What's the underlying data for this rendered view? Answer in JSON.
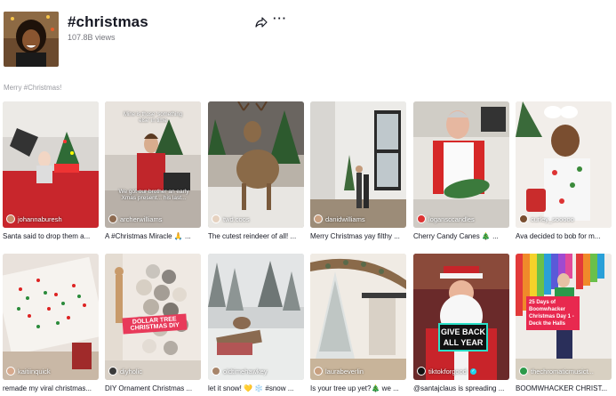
{
  "header": {
    "title": "#christmas",
    "views": "107.8B views",
    "share_icon": "share-arrow-icon",
    "more_icon": "more-dots-icon",
    "more_label": "···"
  },
  "description": "Merry #Christmas!",
  "videos": [
    {
      "author": "johannaburesh",
      "title": "Santa said to drop them a..."
    },
    {
      "author": "archerwilliams",
      "title": "A #Christmas Miracle 🙏 ...",
      "overlay_top": "Mine is those ‘something else’ in time",
      "overlay_mid": "We got our brother an early Xmas present... his last..."
    },
    {
      "author": "twd.coos",
      "title": "The cutest reindeer of all! ..."
    },
    {
      "author": "danidwilliams",
      "title": "Merry Christmas yay filthy ..."
    },
    {
      "author": "logansccandles",
      "title": "Cherry Candy Canes 🎄 ..."
    },
    {
      "author": "curley_sooooo",
      "title": "Ava decided to bob for m..."
    },
    {
      "author": "kaitiinquick",
      "title": "remade my viral christmas..."
    },
    {
      "author": "diyholic",
      "title": "DIY Ornament Christmas ...",
      "banner": "DOLLAR TREE CHRISTMAS DIY"
    },
    {
      "author": "oldtimehawkey",
      "title": "let it snow! 💛 ❄️ #snow ..."
    },
    {
      "author": "laurabeverlin",
      "title": "Is your tree up yet?🎄 we ..."
    },
    {
      "author": "tiktokforgood",
      "title": "@santajclaus is spreading ...",
      "verified": true,
      "banner": "GIVE BACK ALL YEAR"
    },
    {
      "author": "thechromaticmusict...",
      "title": "BOOMWHACKER CHRIST...",
      "banner": "25 Days of Boomwhacker Christmas Day 1 - Deck the Halls"
    }
  ]
}
